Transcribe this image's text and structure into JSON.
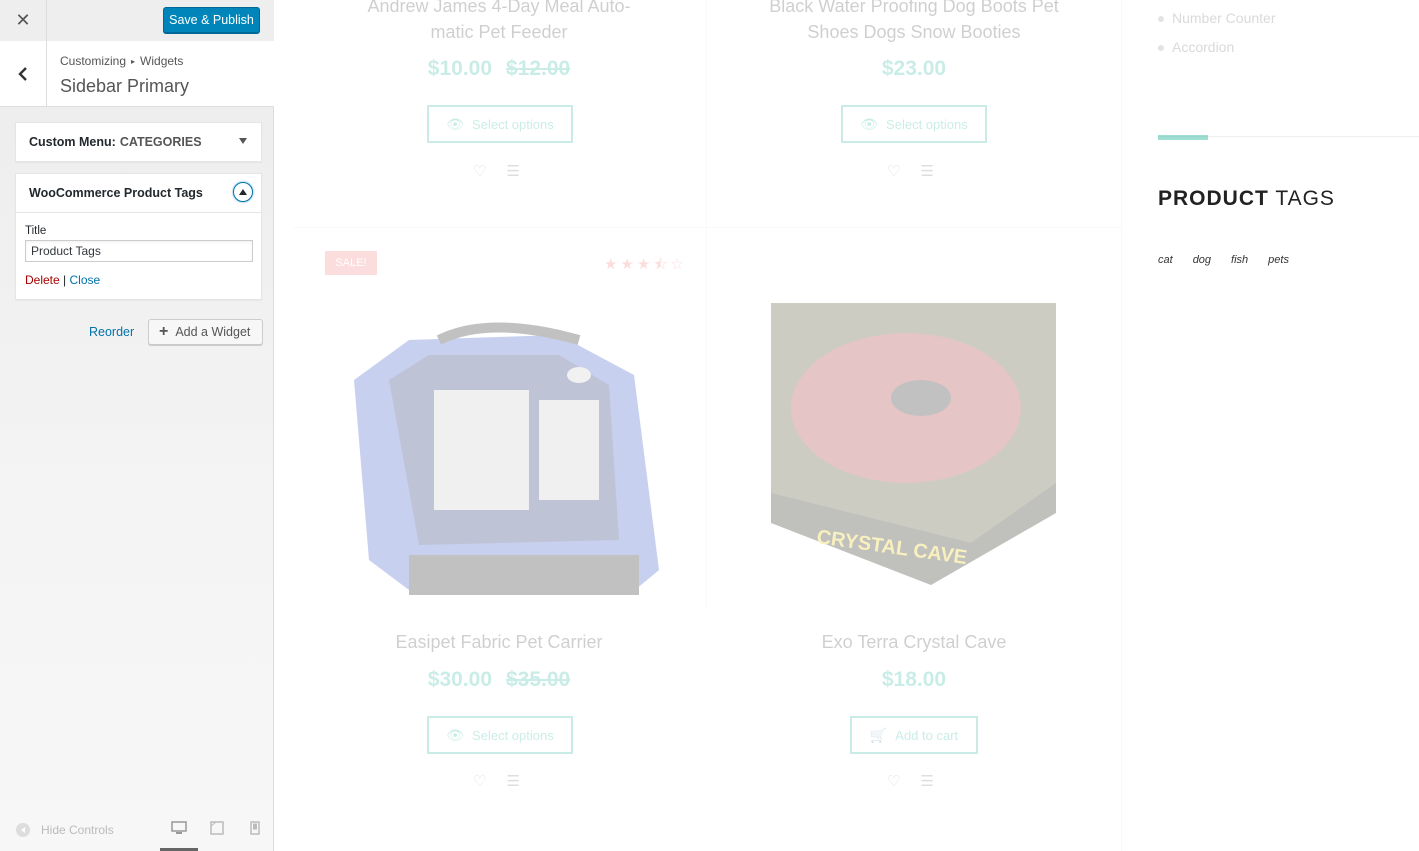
{
  "customizer": {
    "save_label": "Save & Publish",
    "breadcrumb": {
      "root": "Customizing",
      "child": "Widgets"
    },
    "section_title": "Sidebar Primary",
    "widgets": [
      {
        "name": "Custom Menu:",
        "subtitle": "CATEGORIES",
        "expanded": false
      },
      {
        "name": "WooCommerce Product Tags",
        "expanded": true,
        "field_label": "Title",
        "field_value": "Product Tags",
        "delete_label": "Delete",
        "close_label": "Close",
        "divider": "|"
      }
    ],
    "reorder_label": "Reorder",
    "add_widget_label": "Add a Widget",
    "hide_controls_label": "Hide Controls"
  },
  "preview": {
    "products": [
      {
        "title_line1": "Andrew James 4-Day Meal Auto-",
        "title_line2": "matic Pet Feeder",
        "price": "$10.00",
        "old_price": "$12.00",
        "button": "Select options"
      },
      {
        "title_line1": "Black Water Proofing Dog Boots Pet",
        "title_line2": "Shoes Dogs Snow Booties",
        "price": "$23.00",
        "button": "Select options"
      },
      {
        "title": "Easipet Fabric Pet Carrier",
        "price": "$30.00",
        "old_price": "$35.00",
        "button": "Select options",
        "badge": "SALE!",
        "rating": 3.5
      },
      {
        "title": "Exo Terra Crystal Cave",
        "price": "$18.00",
        "button": "Add to cart"
      }
    ],
    "sidebar_list": [
      "Number Counter",
      "Accordion"
    ],
    "tags_heading_bold": "PRODUCT",
    "tags_heading_light": "TAGS",
    "tags": [
      "cat",
      "dog",
      "fish",
      "pets"
    ],
    "accent_color": "#3fbfa7",
    "sale_color": "#f48585",
    "crystal_cave_label": "CRYSTAL CAVE"
  }
}
